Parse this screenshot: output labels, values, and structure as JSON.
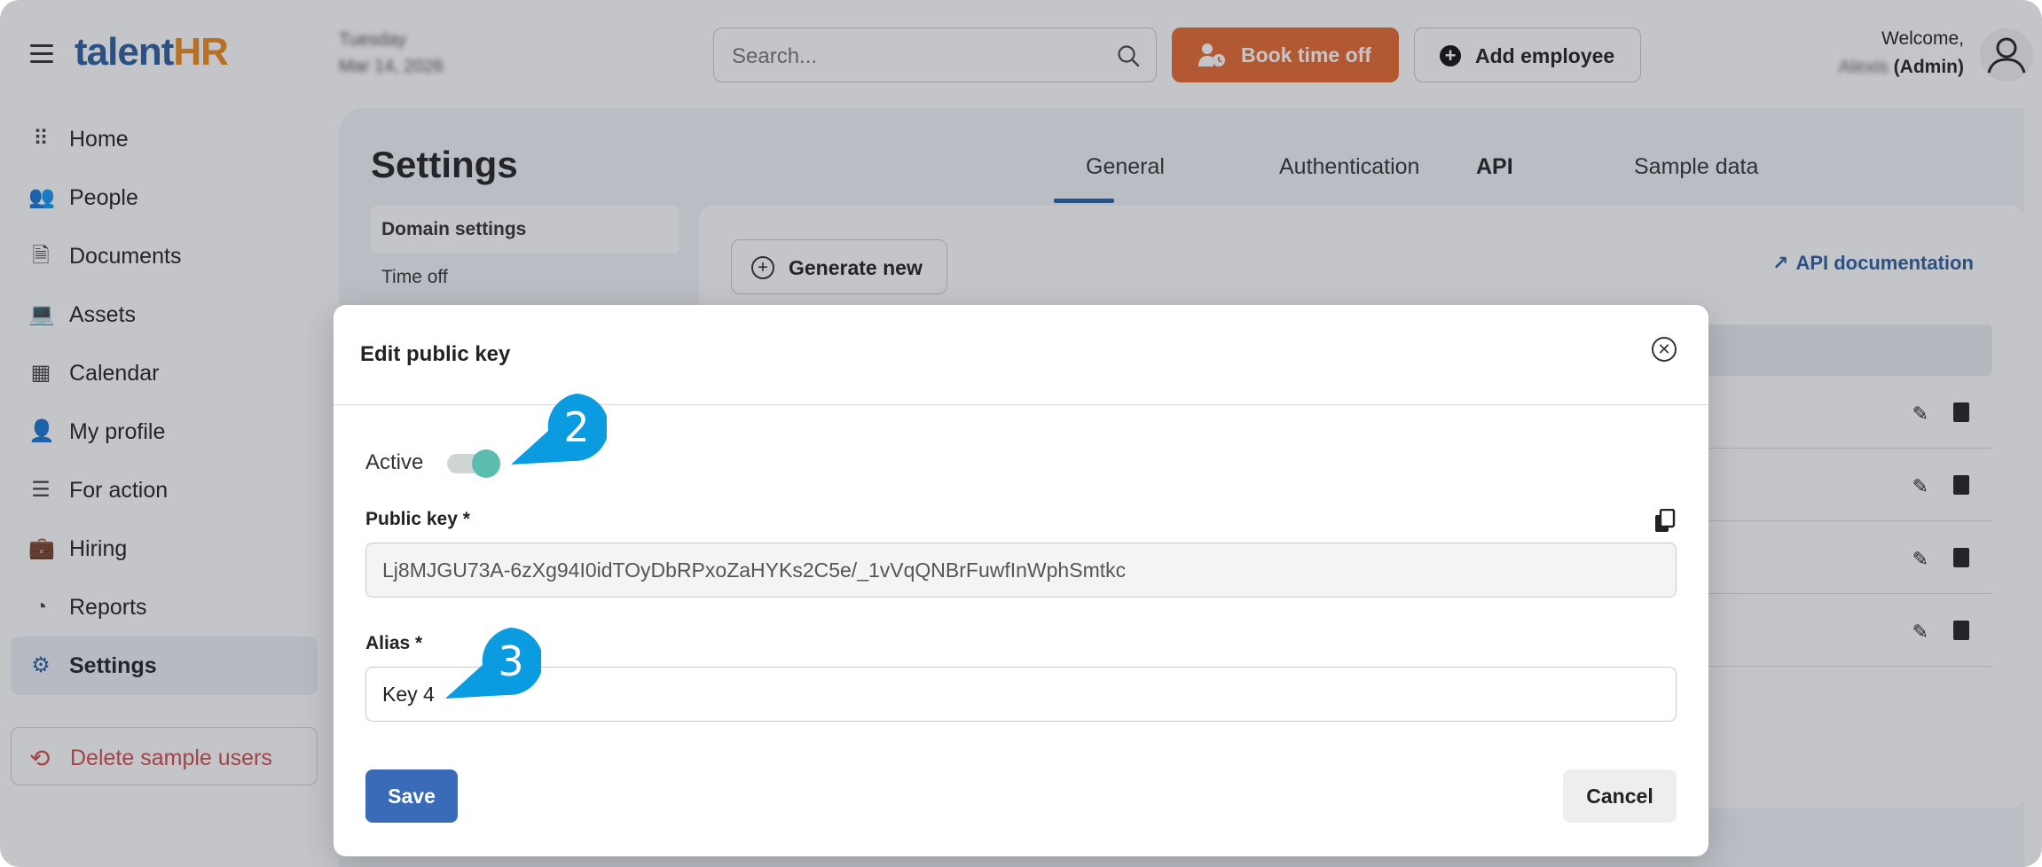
{
  "app": {
    "logo_talent": "talent",
    "logo_hr": "HR"
  },
  "header": {
    "date_line1": "Tuesday",
    "date_line2": "Mar 14, 2026",
    "search_placeholder": "Search...",
    "book_time_off_label": "Book time off",
    "add_employee_label": "Add employee",
    "welcome_line": "Welcome,",
    "user_name": "Alexis",
    "user_role": "(Admin)"
  },
  "sidebar": {
    "items": [
      {
        "label": "Home",
        "icon": "grid-icon"
      },
      {
        "label": "People",
        "icon": "people-icon"
      },
      {
        "label": "Documents",
        "icon": "document-icon"
      },
      {
        "label": "Assets",
        "icon": "laptop-icon"
      },
      {
        "label": "Calendar",
        "icon": "calendar-icon"
      },
      {
        "label": "My profile",
        "icon": "user-icon"
      },
      {
        "label": "For action",
        "icon": "checklist-icon"
      },
      {
        "label": "Hiring",
        "icon": "briefcase-icon"
      },
      {
        "label": "Reports",
        "icon": "pie-chart-icon"
      },
      {
        "label": "Settings",
        "icon": "gear-icon",
        "active": true
      }
    ],
    "delete_sample_users_label": "Delete sample users"
  },
  "settings": {
    "title": "Settings",
    "subnav": [
      "Domain settings",
      "Time off"
    ],
    "tabs": [
      "General",
      "Authentication",
      "API",
      "Sample data"
    ],
    "active_tab": "API",
    "generate_new_label": "Generate new",
    "api_documentation_label": "API documentation"
  },
  "modal": {
    "title": "Edit public key",
    "active_label": "Active",
    "active_value": true,
    "public_key_label": "Public key *",
    "public_key_value": "Lj8MJGU73A-6zXg94I0idTOyDbRPxoZaHYKs2C5e/_1vVqQNBrFuwfInWphSmtkc",
    "alias_label": "Alias *",
    "alias_value": "Key 4",
    "save_label": "Save",
    "cancel_label": "Cancel"
  },
  "callouts": {
    "toggle_step": "2",
    "alias_step": "3"
  },
  "colors": {
    "brand_blue": "#2d5f9e",
    "brand_orange": "#e8692e",
    "toggle_on": "#5bbcb0",
    "callout_blue": "#0a9be0",
    "danger": "#d14b4b"
  }
}
